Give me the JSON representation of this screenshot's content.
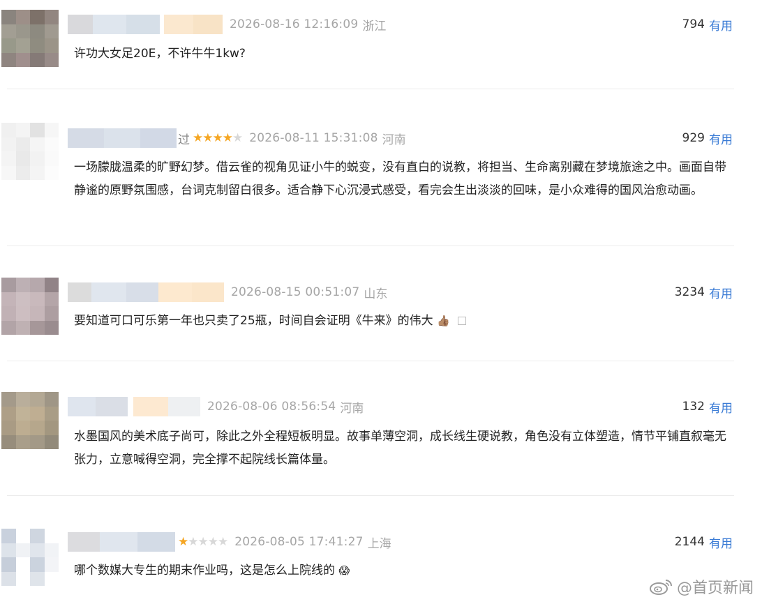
{
  "reviews": [
    {
      "name_suffix": "",
      "rating": 0,
      "time": "2026-08-16 12:16:09",
      "location": "浙江",
      "useful_count": "794",
      "useful_label": "有用",
      "text": "许功大女足20E，不许牛牛1kw?"
    },
    {
      "name_suffix": "过",
      "rating": 4,
      "time": "2026-08-11 15:31:08",
      "location": "河南",
      "useful_count": "929",
      "useful_label": "有用",
      "text": "一场朦胧温柔的旷野幻梦。借云雀的视角见证小牛的蜕变，没有直白的说教，将担当、生命离别藏在梦境旅途之中。画面自带静谧的原野氛围感，台词克制留白很多。适合静下心沉浸式感受，看完会生出淡淡的回味，是小众难得的国风治愈动画。"
    },
    {
      "name_suffix": "",
      "rating": 0,
      "time": "2026-08-15 00:51:07",
      "location": "山东",
      "useful_count": "3234",
      "useful_label": "有用",
      "text": "要知道可口可乐第一年也只卖了25瓶，时间自会证明《牛来》的伟大",
      "emoji": "👍🏽"
    },
    {
      "name_suffix": "",
      "rating": 0,
      "time": "2026-08-06 08:56:54",
      "location": "河南",
      "useful_count": "132",
      "useful_label": "有用",
      "text": "水墨国风的美术底子尚可，除此之外全程短板明显。故事单薄空洞，成长线生硬说教，角色没有立体塑造，情节平铺直叙毫无张力，立意喊得空洞，完全撑不起院线长篇体量。"
    },
    {
      "name_suffix": "",
      "rating": 1,
      "time": "2026-08-05 17:41:27",
      "location": "上海",
      "useful_count": "2144",
      "useful_label": "有用",
      "text": "哪个数媒大专生的期末作业吗，这是怎么上院线的",
      "emoji": "😱"
    }
  ],
  "watermark": {
    "text": "@首页新闻"
  },
  "colors": {
    "star": "#f5a623",
    "useful": "#3a7bd5",
    "meta": "#a6a6a6"
  }
}
